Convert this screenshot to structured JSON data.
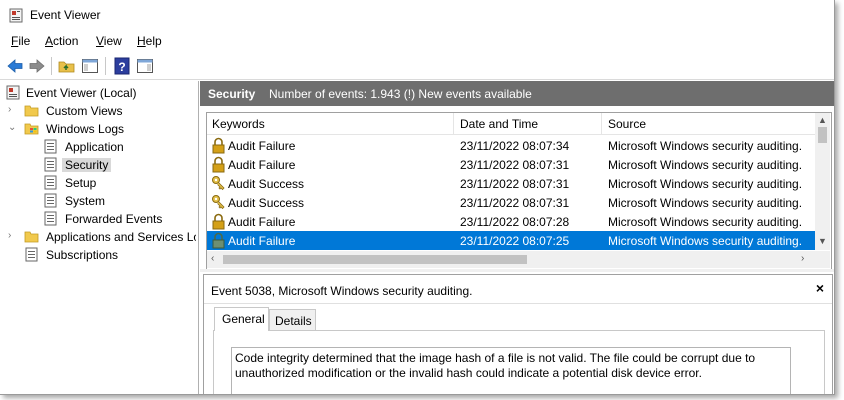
{
  "window": {
    "title": "Event Viewer",
    "app_icon": "event-viewer-icon"
  },
  "menu": {
    "file": {
      "hot": "F",
      "rest": "ile"
    },
    "action": {
      "hot": "A",
      "rest": "ction"
    },
    "view": {
      "hot": "V",
      "rest": "iew"
    },
    "help": {
      "hot": "H",
      "rest": "elp"
    }
  },
  "toolbar": {
    "icons": [
      "back-arrow-icon",
      "forward-arrow-icon",
      "up-folder-icon",
      "show-hide-tree-icon",
      "help-icon",
      "show-hide-action-pane-icon"
    ]
  },
  "tree": {
    "root": "Event Viewer (Local)",
    "custom_views": "Custom Views",
    "windows_logs": "Windows Logs",
    "application": "Application",
    "security": "Security",
    "setup": "Setup",
    "system": "System",
    "forwarded_events": "Forwarded Events",
    "apps_services": "Applications and Services Lo",
    "subscriptions": "Subscriptions"
  },
  "log_header": {
    "title": "Security",
    "count_text": "Number of events: 1.943 (!) New events available"
  },
  "table": {
    "columns": {
      "keywords": "Keywords",
      "date_time": "Date and Time",
      "source": "Source"
    },
    "rows": [
      {
        "keyword": "Audit Failure",
        "date": "23/11/2022 08:07:34",
        "source": "Microsoft Windows security auditing.",
        "icon": "lock-icon"
      },
      {
        "keyword": "Audit Failure",
        "date": "23/11/2022 08:07:31",
        "source": "Microsoft Windows security auditing.",
        "icon": "lock-icon"
      },
      {
        "keyword": "Audit Success",
        "date": "23/11/2022 08:07:31",
        "source": "Microsoft Windows security auditing.",
        "icon": "key-icon"
      },
      {
        "keyword": "Audit Success",
        "date": "23/11/2022 08:07:31",
        "source": "Microsoft Windows security auditing.",
        "icon": "key-icon"
      },
      {
        "keyword": "Audit Failure",
        "date": "23/11/2022 08:07:28",
        "source": "Microsoft Windows security auditing.",
        "icon": "lock-icon"
      },
      {
        "keyword": "Audit Failure",
        "date": "23/11/2022 08:07:25",
        "source": "Microsoft Windows security auditing.",
        "icon": "lock-icon",
        "selected": true
      }
    ]
  },
  "details": {
    "title": "Event 5038, Microsoft Windows security auditing.",
    "close": "×",
    "tabs": {
      "general": "General",
      "details": "Details"
    },
    "description": "Code integrity determined that the image hash of a file is not valid.  The file could be corrupt due to unauthorized modification or the invalid hash could indicate a potential disk device error."
  },
  "colors": {
    "selection": "#0078d7",
    "header_bar": "#6e6e6e",
    "lock_gold": "#d4a017",
    "key_gold": "#c9a227"
  }
}
